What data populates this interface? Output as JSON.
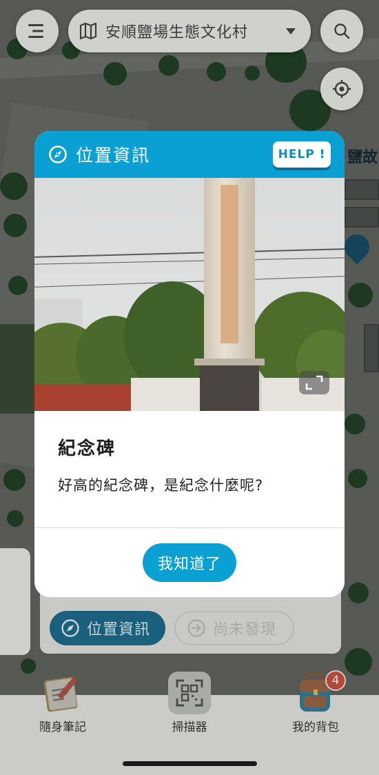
{
  "header": {
    "menu_icon": "menu-icon",
    "place_selector": {
      "map_icon": "map-icon",
      "value": "安順鹽場生態文化村",
      "caret_icon": "chevron-down-icon"
    },
    "search_icon": "search-icon",
    "locate_icon": "crosshair-icon"
  },
  "map": {
    "visible_label": "鹽故"
  },
  "bottom_panel": {
    "location_info_chip": "位置資訊",
    "undiscovered_chip": "尚未發現"
  },
  "tabbar": {
    "tabs": [
      {
        "label": "隨身筆記",
        "icon": "notebook-icon"
      },
      {
        "label": "掃描器",
        "icon": "qr-scanner-icon"
      },
      {
        "label": "我的背包",
        "icon": "backpack-icon",
        "badge": "4"
      }
    ]
  },
  "modal": {
    "title": "位置資訊",
    "title_icon": "compass-icon",
    "help_label": "HELP !",
    "photo_expand_icon": "expand-icon",
    "place_name": "紀念碑",
    "description": "好高的紀念碑，是紀念什麼呢?",
    "confirm_label": "我知道了"
  },
  "colors": {
    "accent": "#0aa0d3",
    "modal_bg": "#ffffff",
    "badge": "#b1483c"
  }
}
